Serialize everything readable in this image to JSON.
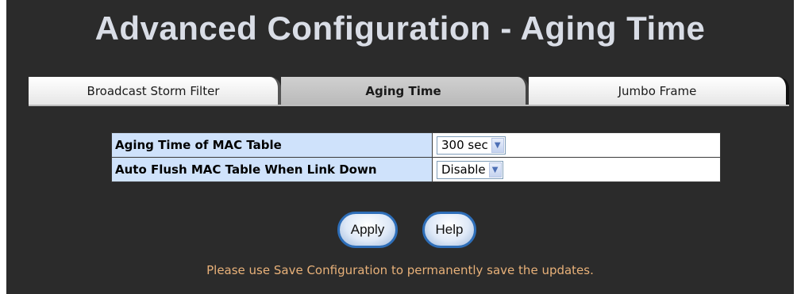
{
  "page": {
    "title": "Advanced Configuration - Aging Time"
  },
  "tabs": [
    {
      "label": "Broadcast Storm Filter",
      "active": false
    },
    {
      "label": "Aging Time",
      "active": true
    },
    {
      "label": "Jumbo Frame",
      "active": false
    }
  ],
  "settings": [
    {
      "label": "Aging Time of MAC Table",
      "value": "300 sec"
    },
    {
      "label": "Auto Flush MAC Table When Link Down",
      "value": "Disable"
    }
  ],
  "buttons": {
    "apply": "Apply",
    "help": "Help"
  },
  "notice": "Please use Save Configuration to permanently save the updates.",
  "colors": {
    "background": "#2b2b2b",
    "label_cell": "#cfe2fb",
    "notice_text": "#e8b179",
    "button_border": "#2e6eb8"
  }
}
